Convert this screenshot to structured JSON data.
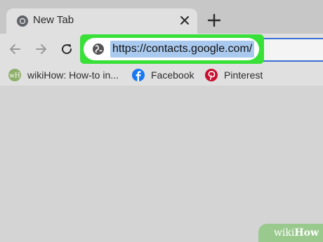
{
  "tab": {
    "title": "New Tab",
    "favicon": "chrome-icon",
    "close_icon": "close-icon"
  },
  "toolbar": {
    "new_tab_icon": "plus-icon",
    "back_icon": "arrow-left-icon",
    "forward_icon": "arrow-right-icon",
    "reload_icon": "reload-icon"
  },
  "omnibox": {
    "url": "https://contacts.google.com/",
    "site_icon": "globe-icon",
    "highlight_color": "#38e038",
    "selection_color": "#a9c9ee"
  },
  "bookmarks": [
    {
      "label": "wikiHow: How-to in...",
      "icon": "wikihow-icon"
    },
    {
      "label": "Facebook",
      "icon": "facebook-icon"
    },
    {
      "label": "Pinterest",
      "icon": "pinterest-icon"
    }
  ],
  "watermark": {
    "prefix": "wiki",
    "suffix": "How"
  }
}
